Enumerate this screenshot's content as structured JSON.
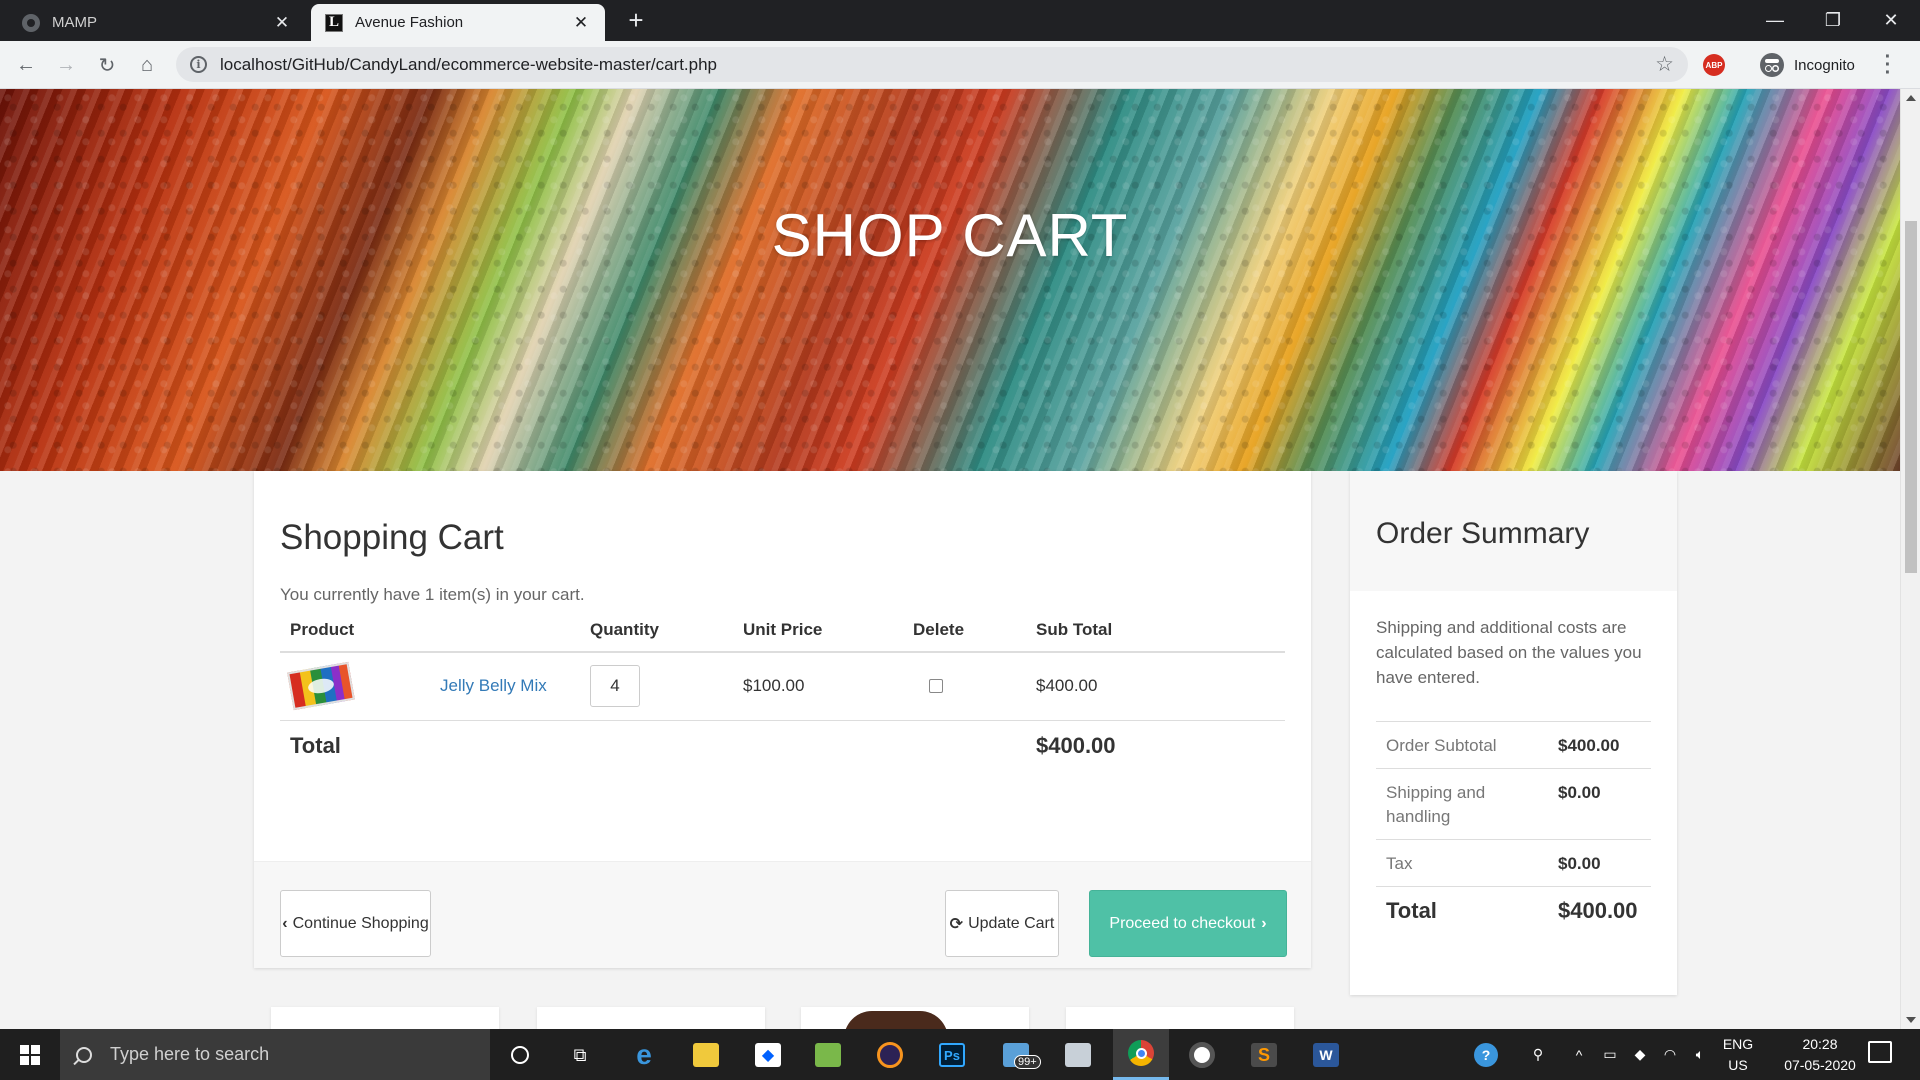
{
  "browser": {
    "tabs": [
      {
        "title": "MAMP",
        "active": false
      },
      {
        "title": "Avenue Fashion",
        "active": true
      }
    ],
    "new_tab": "+",
    "url": "localhost/GitHub/CandyLand/ecommerce-website-master/cart.php",
    "abp_label": "ABP",
    "profile_label": "Incognito"
  },
  "hero": {
    "title": "SHOP CART"
  },
  "cart": {
    "heading": "Shopping Cart",
    "intro": "You currently have 1 item(s) in your cart.",
    "columns": [
      "Product",
      "Quantity",
      "Unit Price",
      "Delete",
      "Sub Total"
    ],
    "items": [
      {
        "name": "Jelly Belly Mix",
        "quantity": "4",
        "unit_price": "$100.00",
        "sub_total": "$400.00",
        "delete_checked": false
      }
    ],
    "total_label": "Total",
    "total_value": "$400.00",
    "continue_label": "Continue Shopping",
    "update_label": "Update Cart",
    "checkout_label": "Proceed to checkout"
  },
  "summary": {
    "heading": "Order Summary",
    "note": "Shipping and additional costs are calculated based on the values you have entered.",
    "rows": [
      {
        "label": "Order Subtotal",
        "value": "$400.00"
      },
      {
        "label": "Shipping and handling",
        "value": "$0.00"
      },
      {
        "label": "Tax",
        "value": "$0.00"
      }
    ],
    "total_label": "Total",
    "total_value": "$400.00"
  },
  "taskbar": {
    "search_placeholder": "Type here to search",
    "mail_badge": "99+",
    "lang_line1": "ENG",
    "lang_line2": "US",
    "time": "20:28",
    "date": "07-05-2020"
  },
  "colors": {
    "accent": "#4fc1a6",
    "link": "#337ab7",
    "chrome_dark": "#202124"
  }
}
